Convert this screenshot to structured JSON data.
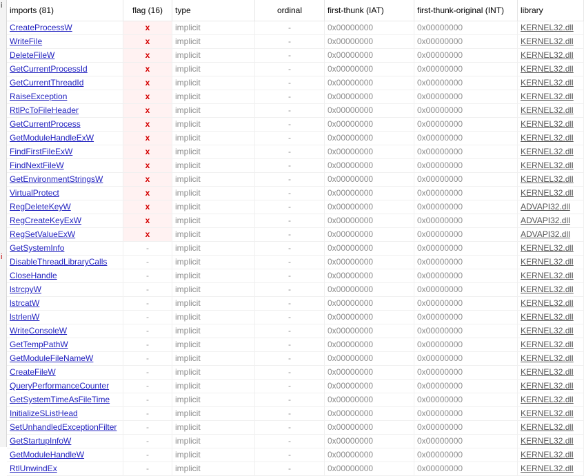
{
  "left_markers": [
    "i",
    "i"
  ],
  "columns": {
    "name": "imports (81)",
    "flag": "flag (16)",
    "type": "type",
    "ordinal": "ordinal",
    "iat": "first-thunk (IAT)",
    "int": "first-thunk-original (INT)",
    "library": "library"
  },
  "rows": [
    {
      "name": "CreateProcessW",
      "flag": "x",
      "type": "implicit",
      "ordinal": "-",
      "iat": "0x00000000",
      "int": "0x00000000",
      "library": "KERNEL32.dll"
    },
    {
      "name": "WriteFile",
      "flag": "x",
      "type": "implicit",
      "ordinal": "-",
      "iat": "0x00000000",
      "int": "0x00000000",
      "library": "KERNEL32.dll"
    },
    {
      "name": "DeleteFileW",
      "flag": "x",
      "type": "implicit",
      "ordinal": "-",
      "iat": "0x00000000",
      "int": "0x00000000",
      "library": "KERNEL32.dll"
    },
    {
      "name": "GetCurrentProcessId",
      "flag": "x",
      "type": "implicit",
      "ordinal": "-",
      "iat": "0x00000000",
      "int": "0x00000000",
      "library": "KERNEL32.dll"
    },
    {
      "name": "GetCurrentThreadId",
      "flag": "x",
      "type": "implicit",
      "ordinal": "-",
      "iat": "0x00000000",
      "int": "0x00000000",
      "library": "KERNEL32.dll"
    },
    {
      "name": "RaiseException",
      "flag": "x",
      "type": "implicit",
      "ordinal": "-",
      "iat": "0x00000000",
      "int": "0x00000000",
      "library": "KERNEL32.dll"
    },
    {
      "name": "RtlPcToFileHeader",
      "flag": "x",
      "type": "implicit",
      "ordinal": "-",
      "iat": "0x00000000",
      "int": "0x00000000",
      "library": "KERNEL32.dll"
    },
    {
      "name": "GetCurrentProcess",
      "flag": "x",
      "type": "implicit",
      "ordinal": "-",
      "iat": "0x00000000",
      "int": "0x00000000",
      "library": "KERNEL32.dll"
    },
    {
      "name": "GetModuleHandleExW",
      "flag": "x",
      "type": "implicit",
      "ordinal": "-",
      "iat": "0x00000000",
      "int": "0x00000000",
      "library": "KERNEL32.dll"
    },
    {
      "name": "FindFirstFileExW",
      "flag": "x",
      "type": "implicit",
      "ordinal": "-",
      "iat": "0x00000000",
      "int": "0x00000000",
      "library": "KERNEL32.dll"
    },
    {
      "name": "FindNextFileW",
      "flag": "x",
      "type": "implicit",
      "ordinal": "-",
      "iat": "0x00000000",
      "int": "0x00000000",
      "library": "KERNEL32.dll"
    },
    {
      "name": "GetEnvironmentStringsW",
      "flag": "x",
      "type": "implicit",
      "ordinal": "-",
      "iat": "0x00000000",
      "int": "0x00000000",
      "library": "KERNEL32.dll"
    },
    {
      "name": "VirtualProtect",
      "flag": "x",
      "type": "implicit",
      "ordinal": "-",
      "iat": "0x00000000",
      "int": "0x00000000",
      "library": "KERNEL32.dll"
    },
    {
      "name": "RegDeleteKeyW",
      "flag": "x",
      "type": "implicit",
      "ordinal": "-",
      "iat": "0x00000000",
      "int": "0x00000000",
      "library": "ADVAPI32.dll"
    },
    {
      "name": "RegCreateKeyExW",
      "flag": "x",
      "type": "implicit",
      "ordinal": "-",
      "iat": "0x00000000",
      "int": "0x00000000",
      "library": "ADVAPI32.dll"
    },
    {
      "name": "RegSetValueExW",
      "flag": "x",
      "type": "implicit",
      "ordinal": "-",
      "iat": "0x00000000",
      "int": "0x00000000",
      "library": "ADVAPI32.dll"
    },
    {
      "name": "GetSystemInfo",
      "flag": "-",
      "type": "implicit",
      "ordinal": "-",
      "iat": "0x00000000",
      "int": "0x00000000",
      "library": "KERNEL32.dll"
    },
    {
      "name": "DisableThreadLibraryCalls",
      "flag": "-",
      "type": "implicit",
      "ordinal": "-",
      "iat": "0x00000000",
      "int": "0x00000000",
      "library": "KERNEL32.dll"
    },
    {
      "name": "CloseHandle",
      "flag": "-",
      "type": "implicit",
      "ordinal": "-",
      "iat": "0x00000000",
      "int": "0x00000000",
      "library": "KERNEL32.dll"
    },
    {
      "name": "lstrcpyW",
      "flag": "-",
      "type": "implicit",
      "ordinal": "-",
      "iat": "0x00000000",
      "int": "0x00000000",
      "library": "KERNEL32.dll"
    },
    {
      "name": "lstrcatW",
      "flag": "-",
      "type": "implicit",
      "ordinal": "-",
      "iat": "0x00000000",
      "int": "0x00000000",
      "library": "KERNEL32.dll"
    },
    {
      "name": "lstrlenW",
      "flag": "-",
      "type": "implicit",
      "ordinal": "-",
      "iat": "0x00000000",
      "int": "0x00000000",
      "library": "KERNEL32.dll"
    },
    {
      "name": "WriteConsoleW",
      "flag": "-",
      "type": "implicit",
      "ordinal": "-",
      "iat": "0x00000000",
      "int": "0x00000000",
      "library": "KERNEL32.dll"
    },
    {
      "name": "GetTempPathW",
      "flag": "-",
      "type": "implicit",
      "ordinal": "-",
      "iat": "0x00000000",
      "int": "0x00000000",
      "library": "KERNEL32.dll"
    },
    {
      "name": "GetModuleFileNameW",
      "flag": "-",
      "type": "implicit",
      "ordinal": "-",
      "iat": "0x00000000",
      "int": "0x00000000",
      "library": "KERNEL32.dll"
    },
    {
      "name": "CreateFileW",
      "flag": "-",
      "type": "implicit",
      "ordinal": "-",
      "iat": "0x00000000",
      "int": "0x00000000",
      "library": "KERNEL32.dll"
    },
    {
      "name": "QueryPerformanceCounter",
      "flag": "-",
      "type": "implicit",
      "ordinal": "-",
      "iat": "0x00000000",
      "int": "0x00000000",
      "library": "KERNEL32.dll"
    },
    {
      "name": "GetSystemTimeAsFileTime",
      "flag": "-",
      "type": "implicit",
      "ordinal": "-",
      "iat": "0x00000000",
      "int": "0x00000000",
      "library": "KERNEL32.dll"
    },
    {
      "name": "InitializeSListHead",
      "flag": "-",
      "type": "implicit",
      "ordinal": "-",
      "iat": "0x00000000",
      "int": "0x00000000",
      "library": "KERNEL32.dll"
    },
    {
      "name": "SetUnhandledExceptionFilter",
      "flag": "-",
      "type": "implicit",
      "ordinal": "-",
      "iat": "0x00000000",
      "int": "0x00000000",
      "library": "KERNEL32.dll"
    },
    {
      "name": "GetStartupInfoW",
      "flag": "-",
      "type": "implicit",
      "ordinal": "-",
      "iat": "0x00000000",
      "int": "0x00000000",
      "library": "KERNEL32.dll"
    },
    {
      "name": "GetModuleHandleW",
      "flag": "-",
      "type": "implicit",
      "ordinal": "-",
      "iat": "0x00000000",
      "int": "0x00000000",
      "library": "KERNEL32.dll"
    },
    {
      "name": "RtlUnwindEx",
      "flag": "-",
      "type": "implicit",
      "ordinal": "-",
      "iat": "0x00000000",
      "int": "0x00000000",
      "library": "KERNEL32.dll"
    }
  ]
}
